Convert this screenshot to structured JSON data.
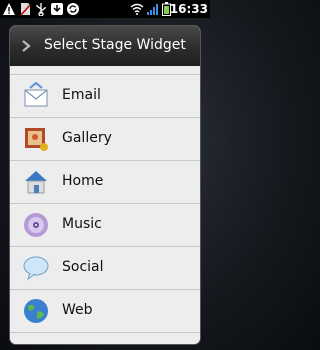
{
  "status_bar": {
    "time": "16:33",
    "icons": [
      "warning-icon",
      "sd-card-icon",
      "usb-icon",
      "download-icon",
      "sync-icon",
      "wifi-icon",
      "signal-icon",
      "battery-icon"
    ]
  },
  "dialog": {
    "title": "Select Stage Widget",
    "items": [
      {
        "label": "Email",
        "icon": "email-icon"
      },
      {
        "label": "Gallery",
        "icon": "gallery-icon"
      },
      {
        "label": "Home",
        "icon": "home-icon"
      },
      {
        "label": "Music",
        "icon": "music-icon"
      },
      {
        "label": "Social",
        "icon": "social-icon"
      },
      {
        "label": "Web",
        "icon": "web-icon"
      }
    ]
  },
  "colors": {
    "header_bg": "#2c2c2c",
    "list_bg": "#ededed",
    "divider": "#c8c8c8"
  }
}
